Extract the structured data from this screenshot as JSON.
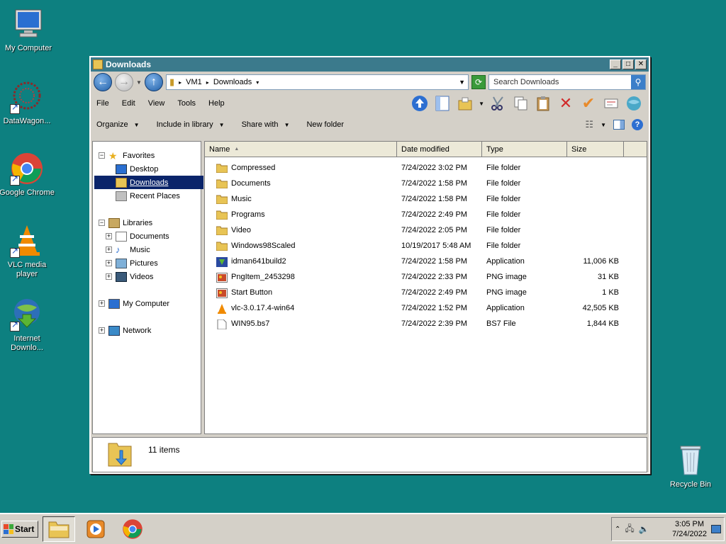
{
  "desktop": {
    "icons": [
      {
        "label": "My Computer"
      },
      {
        "label": "DataWagon..."
      },
      {
        "label": "Google Chrome"
      },
      {
        "label": "VLC media player"
      },
      {
        "label": "Internet Downlo..."
      },
      {
        "label": "Recycle Bin"
      }
    ]
  },
  "window": {
    "title": "Downloads",
    "address": {
      "crumbs": [
        "VM1",
        "Downloads"
      ],
      "search_placeholder": "Search Downloads"
    },
    "menu": [
      "File",
      "Edit",
      "View",
      "Tools",
      "Help"
    ],
    "commands": {
      "organize": "Organize",
      "include": "Include in library",
      "share": "Share with",
      "newfolder": "New folder"
    },
    "nav": {
      "favorites": "Favorites",
      "desktop": "Desktop",
      "downloads": "Downloads",
      "recent": "Recent Places",
      "libraries": "Libraries",
      "documents": "Documents",
      "music": "Music",
      "pictures": "Pictures",
      "videos": "Videos",
      "mycomputer": "My Computer",
      "network": "Network"
    },
    "columns": {
      "name": "Name",
      "date": "Date modified",
      "type": "Type",
      "size": "Size"
    },
    "files": [
      {
        "name": "Compressed",
        "date": "7/24/2022 3:02 PM",
        "type": "File folder",
        "size": "",
        "icon": "folder-icon"
      },
      {
        "name": "Documents",
        "date": "7/24/2022 1:58 PM",
        "type": "File folder",
        "size": "",
        "icon": "folder-icon"
      },
      {
        "name": "Music",
        "date": "7/24/2022 1:58 PM",
        "type": "File folder",
        "size": "",
        "icon": "folder-icon"
      },
      {
        "name": "Programs",
        "date": "7/24/2022 2:49 PM",
        "type": "File folder",
        "size": "",
        "icon": "folder-icon"
      },
      {
        "name": "Video",
        "date": "7/24/2022 2:05 PM",
        "type": "File folder",
        "size": "",
        "icon": "folder-icon"
      },
      {
        "name": "Windows98Scaled",
        "date": "10/19/2017 5:48 AM",
        "type": "File folder",
        "size": "",
        "icon": "folder-icon"
      },
      {
        "name": "idman641build2",
        "date": "7/24/2022 1:58 PM",
        "type": "Application",
        "size": "11,006 KB",
        "icon": "installer-icon"
      },
      {
        "name": "PngItem_2453298",
        "date": "7/24/2022 2:33 PM",
        "type": "PNG image",
        "size": "31 KB",
        "icon": "image-icon"
      },
      {
        "name": "Start Button",
        "date": "7/24/2022 2:49 PM",
        "type": "PNG image",
        "size": "1 KB",
        "icon": "image-icon"
      },
      {
        "name": "vlc-3.0.17.4-win64",
        "date": "7/24/2022 1:52 PM",
        "type": "Application",
        "size": "42,505 KB",
        "icon": "vlc-icon"
      },
      {
        "name": "WIN95.bs7",
        "date": "7/24/2022 2:39 PM",
        "type": "BS7 File",
        "size": "1,844 KB",
        "icon": "file-icon"
      }
    ],
    "status": {
      "count": "11 items"
    }
  },
  "taskbar": {
    "start": "Start",
    "time": "3:05 PM",
    "date": "7/24/2022"
  }
}
